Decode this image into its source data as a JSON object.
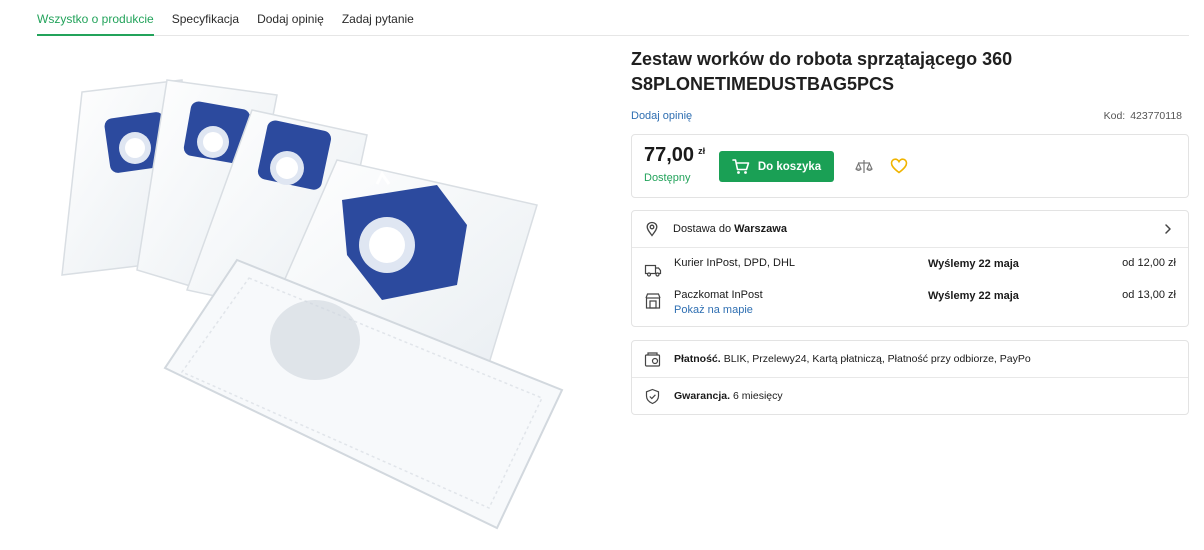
{
  "tabs": [
    {
      "label": "Wszystko o produkcie",
      "active": true
    },
    {
      "label": "Specyfikacja",
      "active": false
    },
    {
      "label": "Dodaj opinię",
      "active": false
    },
    {
      "label": "Zadaj pytanie",
      "active": false
    }
  ],
  "product": {
    "title_line1": "Zestaw worków do robota sprzątającego 360",
    "title_line2": "S8PLONETIMEDUSTBAG5PCS",
    "add_review": "Dodaj opinię",
    "code_label": "Kod:",
    "code_value": "423770118"
  },
  "purchase": {
    "price": "77,00",
    "currency": "zł",
    "availability": "Dostępny",
    "cart_button": "Do koszyka"
  },
  "delivery": {
    "prefix": "Dostawa do",
    "city": "Warszawa",
    "options": [
      {
        "name": "Kurier InPost, DPD, DHL",
        "link": "",
        "when": "Wyślemy 22 maja",
        "price": "od 12,00 zł",
        "icon": "truck-icon"
      },
      {
        "name": "Paczkomat InPost",
        "link": "Pokaż na mapie",
        "when": "Wyślemy 22 maja",
        "price": "od 13,00 zł",
        "icon": "parcel-locker-icon"
      }
    ]
  },
  "payment": {
    "label": "Płatność.",
    "value": "BLIK, Przelewy24, Kartą płatniczą, Płatność przy odbiorze, PayPo"
  },
  "warranty": {
    "label": "Gwarancja.",
    "value": "6 miesięcy"
  },
  "colors": {
    "accent_green": "#1aa055",
    "link_blue": "#2f6fb2",
    "heart_yellow": "#f0b400",
    "bag_blue": "#2c4a9e"
  }
}
